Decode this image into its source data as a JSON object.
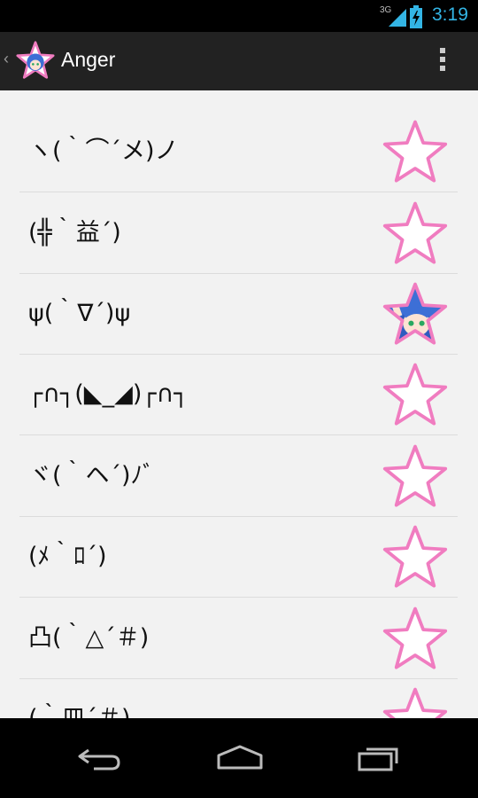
{
  "status_bar": {
    "network": "3G",
    "time": "3:19",
    "colors": {
      "icons": "#33b5e5"
    }
  },
  "action_bar": {
    "title": "Anger",
    "up_icon": "chevron-left-icon",
    "app_icon": "anime-star-icon",
    "overflow_icon": "overflow-menu-icon"
  },
  "emoticons": [
    {
      "text": "ヽ(｀⌒´メ)ノ",
      "favorite": false
    },
    {
      "text": "(╬｀益´)",
      "favorite": false
    },
    {
      "text": "ψ(｀∇´)ψ",
      "favorite": true
    },
    {
      "text": "┌∩┐(◣_◢)┌∩┐",
      "favorite": false
    },
    {
      "text": "ヾ(｀ヘ´)ﾉﾞ",
      "favorite": false
    },
    {
      "text": "(ﾒ｀ﾛ´)",
      "favorite": false
    },
    {
      "text": "凸(｀△´＃)",
      "favorite": false
    },
    {
      "text": "(｀皿´＃)",
      "favorite": false
    }
  ],
  "nav_bar": {
    "back_icon": "back-icon",
    "home_icon": "home-icon",
    "recents_icon": "recent-apps-icon"
  },
  "colors": {
    "star_outline": "#f07cc0",
    "action_bar": "#222222",
    "list_background": "#f2f2f2"
  }
}
